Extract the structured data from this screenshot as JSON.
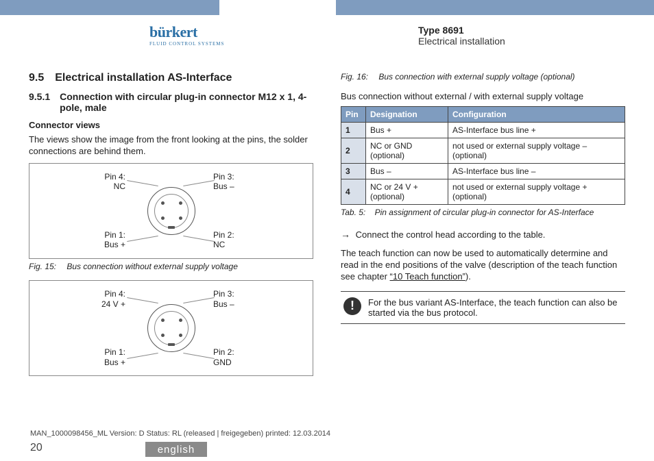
{
  "header": {
    "brand": "bürkert",
    "tagline": "FLUID CONTROL SYSTEMS",
    "type": "Type 8691",
    "section": "Electrical installation"
  },
  "h95": {
    "num": "9.5",
    "title": "Electrical installation AS-Interface"
  },
  "h951": {
    "num": "9.5.1",
    "title": "Connection with circular plug-in connector M12 x 1, 4-pole, male"
  },
  "connector_views": {
    "label": "Connector views",
    "desc": "The views show the image from the front looking at the pins, the solder connections are behind them."
  },
  "fig15": {
    "pin4": "Pin 4:\nNC",
    "pin3": "Pin 3:\nBus –",
    "pin1": "Pin 1:\nBus +",
    "pin2": "Pin 2:\nNC",
    "caption_num": "Fig. 15:",
    "caption": "Bus connection without external supply voltage"
  },
  "fig16": {
    "pin4": "Pin 4:\n24 V +",
    "pin3": "Pin 3:\nBus –",
    "pin1": "Pin 1:\nBus +",
    "pin2": "Pin 2:\nGND",
    "caption_num": "Fig. 16:",
    "caption": "Bus connection with external supply voltage (optional)"
  },
  "table": {
    "intro": "Bus connection without external / with external supply voltage",
    "head": {
      "c1": "Pin",
      "c2": "Designation",
      "c3": "Configuration"
    },
    "rows": [
      {
        "pin": "1",
        "des": "Bus +",
        "conf": "AS-Interface bus line +"
      },
      {
        "pin": "2",
        "des": "NC or GND (optional)",
        "conf": "not used or external supply voltage – (optional)"
      },
      {
        "pin": "3",
        "des": "Bus –",
        "conf": "AS-Interface bus line –"
      },
      {
        "pin": "4",
        "des": "NC or 24 V + (optional)",
        "conf": "not used or external supply voltage + (optional)"
      }
    ],
    "caption_num": "Tab. 5:",
    "caption": "Pin assignment of circular plug-in connector for AS-Interface"
  },
  "connect_line": "Connect the control head according to the table.",
  "teach_text_a": "The teach function can now be used to automatically determine and read in the end positions of the valve (description of the teach function see chapter ",
  "teach_link": "“10 Teach function”",
  "teach_text_b": ").",
  "note": "For the bus variant AS-Interface, the teach function can also be started via the bus protocol.",
  "footer": {
    "meta": "MAN_1000098456_ML  Version: D Status: RL (released | freigegeben)  printed: 12.03.2014",
    "page": "20",
    "lang": "english"
  }
}
